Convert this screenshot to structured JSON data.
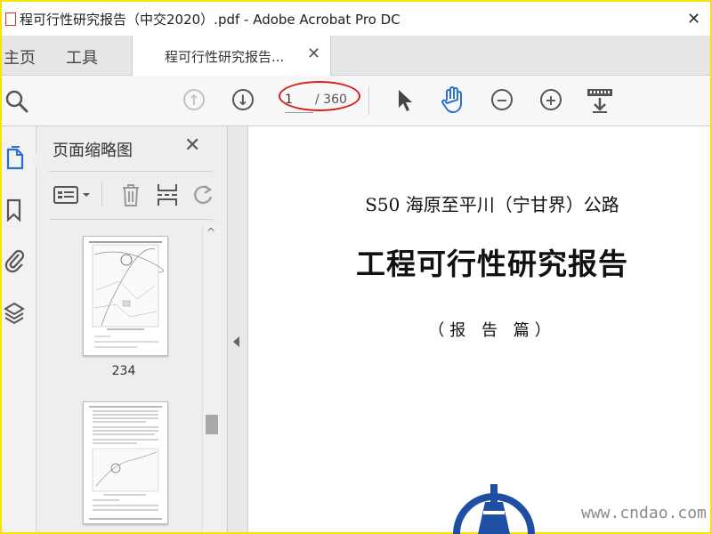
{
  "window": {
    "title": "程可行性研究报告（中交2020）.pdf - Adobe Acrobat Pro DC"
  },
  "tabs": {
    "home": "主页",
    "tools": "工具",
    "document": "程可行性研究报告..."
  },
  "toolbar": {
    "page_current": "1",
    "page_total": "/ 360"
  },
  "panel": {
    "title": "页面缩略图",
    "thumbnails": [
      {
        "label": "234"
      }
    ]
  },
  "document": {
    "subtitle": "S50 海原至平川（宁甘界）公路",
    "main_title": "工程可行性研究报告",
    "part": "（报 告 篇）"
  },
  "watermark": "www.cndao.com",
  "colors": {
    "accent_blue": "#2b6fd0",
    "annotation_red": "#d62020",
    "logo_blue": "#1f4fa3"
  }
}
